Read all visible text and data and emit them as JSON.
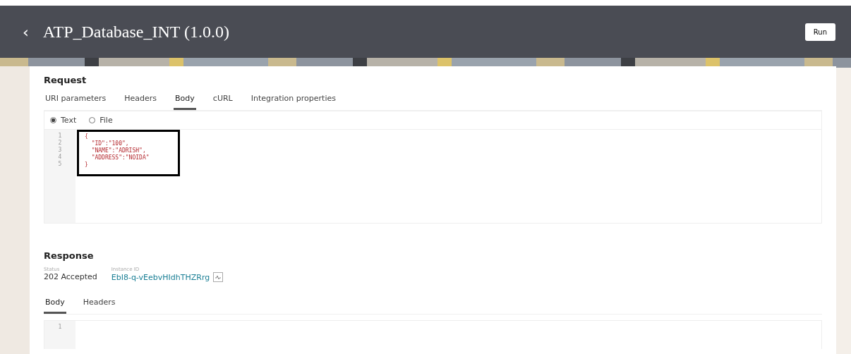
{
  "header": {
    "back": "‹",
    "title": "ATP_Database_INT (1.0.0)",
    "run_button": "Run"
  },
  "request": {
    "title": "Request",
    "tabs": [
      {
        "label": "URI parameters",
        "selected": false
      },
      {
        "label": "Headers",
        "selected": false
      },
      {
        "label": "Body",
        "selected": true
      },
      {
        "label": "cURL",
        "selected": false
      },
      {
        "label": "Integration properties",
        "selected": false
      }
    ],
    "body_type": [
      {
        "label": "Text",
        "selected": true
      },
      {
        "label": "File",
        "selected": false
      }
    ],
    "editor": {
      "lines": [
        {
          "number": "1",
          "text": "{"
        },
        {
          "number": "2",
          "text": "  \"ID\":\"100\","
        },
        {
          "number": "3",
          "text": "  \"NAME\":\"ADRISH\","
        },
        {
          "number": "4",
          "text": "  \"ADDRESS\":\"NOIDA\""
        },
        {
          "number": "5",
          "text": "}"
        }
      ]
    }
  },
  "response": {
    "title": "Response",
    "status_label": "Status",
    "status": "202 Accepted",
    "instance_label": "Instance ID",
    "instance_id": "EbI8-q-vEebvHIdhTHZRrg",
    "tabs": [
      {
        "label": "Body",
        "selected": true
      },
      {
        "label": "Headers",
        "selected": false
      }
    ],
    "editor": {
      "lines": [
        {
          "number": "1"
        }
      ]
    }
  }
}
